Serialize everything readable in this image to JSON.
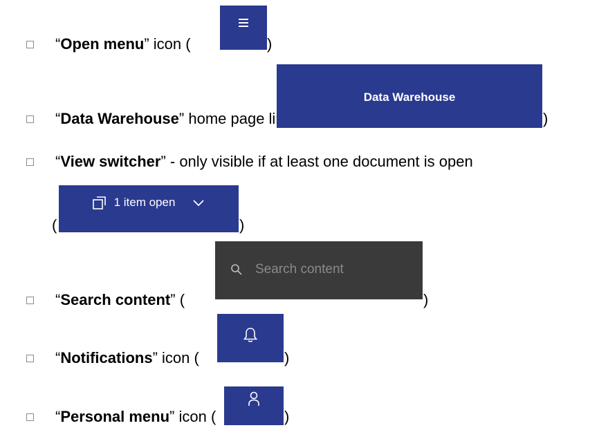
{
  "items": [
    {
      "quote_open": "“",
      "term": "Open menu",
      "rest": "” icon (",
      "close": ")"
    },
    {
      "quote_open": "“",
      "term": "Data Warehouse",
      "rest": "” home page link (",
      "close": ")",
      "image_label": "Data Warehouse"
    },
    {
      "quote_open": "“",
      "term": "View switcher",
      "rest": "” - only visible if at least one document is open",
      "open_paren": "(",
      "close": ")",
      "image_label": "1 item open"
    },
    {
      "quote_open": "“",
      "term": "Search content",
      "rest": "” (",
      "close": ")",
      "image_placeholder": "Search content"
    },
    {
      "quote_open": "“",
      "term": "Notifications",
      "rest": "” icon (",
      "close": ")"
    },
    {
      "quote_open": "“",
      "term": "Personal menu",
      "rest": "” icon (",
      "close": ")"
    }
  ],
  "colors": {
    "header_blue": "#2a3a8f",
    "search_dark": "#3a3a3a",
    "bullet_border": "#8a8a8a"
  },
  "icons": [
    "hamburger-icon",
    "view-switcher-icon",
    "chevron-down-icon",
    "search-icon",
    "bell-icon",
    "user-icon"
  ]
}
